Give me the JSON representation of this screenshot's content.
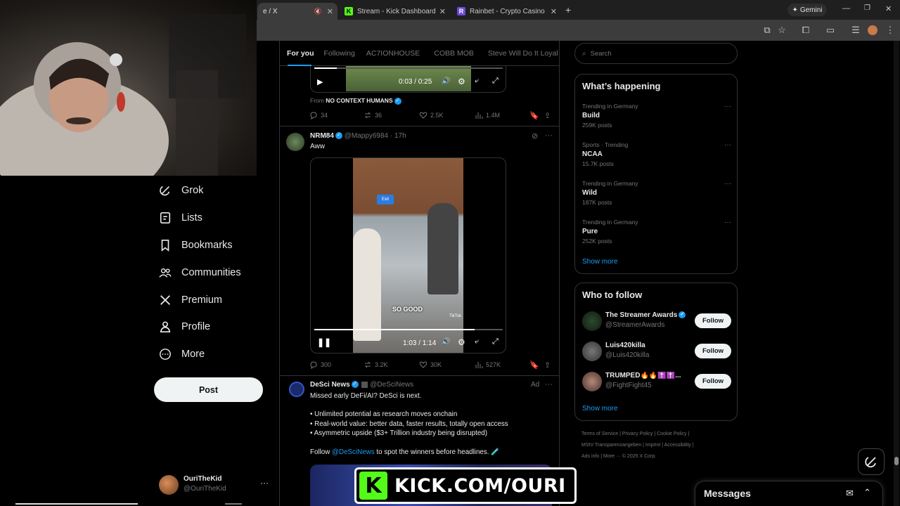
{
  "browser": {
    "tabs": [
      {
        "label": "e / X"
      },
      {
        "label": "Stream - Kick Dashboard"
      },
      {
        "label": "Rainbet - Crypto Casino & Spo"
      }
    ],
    "gemini_label": "Gemini"
  },
  "sidebar": {
    "items": [
      {
        "label": "Grok"
      },
      {
        "label": "Lists"
      },
      {
        "label": "Bookmarks"
      },
      {
        "label": "Communities"
      },
      {
        "label": "Premium"
      },
      {
        "label": "Profile"
      },
      {
        "label": "More"
      }
    ],
    "post_label": "Post",
    "account": {
      "name": "OuriTheKid",
      "handle": "@OuriTheKid"
    }
  },
  "feed": {
    "tabs": [
      "For you",
      "Following",
      "AC7IONHOUSE",
      "COBB MOB",
      "Steve Will Do It Loyal"
    ],
    "post1": {
      "video_time": "0:03 / 0:25",
      "from_prefix": "From",
      "from_name": "NO CONTEXT HUMANS",
      "replies": "34",
      "reposts": "36",
      "likes": "2.5K",
      "views": "1.4M"
    },
    "post2": {
      "name": "NRM84",
      "handle": "@Mappy6984",
      "time": "· 17h",
      "text": "Aww",
      "video_caption": "SO GOOD",
      "video_sign": "Exit",
      "tiktok_label": "TikTok",
      "video_time": "1:03 / 1:14",
      "replies": "300",
      "reposts": "3.2K",
      "likes": "30K",
      "views": "527K"
    },
    "post3": {
      "name": "DeSci News",
      "handle": "@DeSciNews",
      "ad": "Ad",
      "line1": "Missed early DeFi/AI? DeSci is next.",
      "bullets": [
        "• Unlimited potential as research moves onchain",
        "• Real-world value: better data, faster results, totally open access",
        "• Asymmetric upside ($3+ Trillion industry being disrupted)"
      ],
      "follow_prefix": "Follow",
      "follow_handle": "@DeSciNews",
      "follow_suffix": "to spot the winners before headlines. 🧪"
    }
  },
  "overlay": {
    "kick_text": "KICK.COM/OURI"
  },
  "right": {
    "search_placeholder": "Search",
    "happening_title": "What’s happening",
    "trends": [
      {
        "context": "Trending in Germany",
        "name": "Build",
        "count": "259K posts"
      },
      {
        "context": "Sports · Trending",
        "name": "NCAA",
        "count": "15.7K posts"
      },
      {
        "context": "Trending in Germany",
        "name": "Wild",
        "count": "187K posts"
      },
      {
        "context": "Trending in Germany",
        "name": "Pure",
        "count": "252K posts"
      }
    ],
    "show_more": "Show more",
    "who_title": "Who to follow",
    "who": [
      {
        "name": "The Streamer Awards",
        "handle": "@StreamerAwards",
        "button": "Follow"
      },
      {
        "name": "Luis420killa",
        "handle": "@Luis420killa",
        "button": "Follow"
      },
      {
        "name": "TRUMPED🔥🔥✝️✝️...",
        "handle": "@FightFight45",
        "button": "Follow"
      }
    ],
    "footer": {
      "line1": "Terms of Service  |  Privacy Policy  |  Cookie Policy  |",
      "line2": "MStV Transparenzangeben  |  Imprint  |  Accessibility  |",
      "line3": "Ads info  |  More ···  © 2025 X Corp."
    },
    "messages_label": "Messages"
  },
  "colors": {
    "accent": "#1d9bf0",
    "kick_green": "#53fc18",
    "background": "#000000"
  }
}
